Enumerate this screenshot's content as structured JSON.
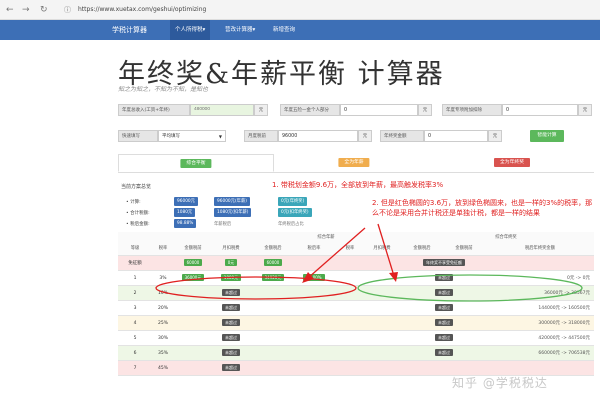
{
  "browser": {
    "url": "https://www.xuetax.com/geshui/optimizing"
  },
  "nav": {
    "brand": "学税计算器",
    "items": [
      "个人所得税▾",
      "营改计算器▾",
      "新增查询"
    ]
  },
  "page": {
    "title": "年终奖&年薪平衡 计算器",
    "subtitle": "知之为知之，不知为不知，是知也"
  },
  "form": {
    "row1": [
      {
        "label": "年度总收入(工资+年终)",
        "value": "",
        "placeholder": "480000",
        "unit": "元"
      },
      {
        "label": "年度五险一金个人部分",
        "value": "0",
        "unit": "元"
      },
      {
        "label": "年度专项附加扣除",
        "value": "0",
        "unit": "元"
      }
    ],
    "row2": {
      "type_label": "快速填写",
      "type_value": "平均填写",
      "salary_label": "月度税前",
      "salary_value": "96000",
      "salary_unit": "元",
      "bonus_label": "年终奖金额",
      "bonus_value": "0",
      "bonus_unit": "元",
      "button": "智能计算"
    }
  },
  "tabs": [
    {
      "label": "综合平衡",
      "color": "#5cb85c"
    },
    {
      "label": "全为年薪",
      "color": "#f0ad4e"
    },
    {
      "label": "全为年终奖",
      "color": "#d9534f"
    }
  ],
  "annotations": {
    "a1": "1. 带税划金额9.6万，全部放到年薪，最高触发税率3%",
    "a2": "2. 但是红色椭圆的3.6万，放到绿色椭圆来，也是一样的3%的税率，那么不论是采用合并计税还是单独计税，都是一样的结果"
  },
  "summary": {
    "heading": "当前方案总览",
    "rows": [
      {
        "label": "• 计算:",
        "chips": [
          "96000元",
          "96000元(年薪)",
          "0元(年终奖)"
        ]
      },
      {
        "label": "• 合计税额:",
        "chips": [
          "1080元",
          "1080元(扣年薪)",
          "0元(扣年终奖)"
        ]
      },
      {
        "label": "• 税后金额:",
        "chips": [
          "98.88%",
          "年薪税后",
          "年终税后占比"
        ]
      }
    ]
  },
  "table": {
    "group_left": "综合年薪",
    "group_right": "综合年终奖",
    "headers": [
      "等级",
      "税率",
      "金额税前",
      "月扣税费",
      "金额税后",
      "税后率",
      "税率",
      "月扣税费",
      "金额税后",
      "金额税前",
      "税后年终奖金额"
    ],
    "rows": [
      {
        "level": "免征额",
        "rate": "",
        "pre": "60000",
        "tax": "0元",
        "after": "60000",
        "pct": "",
        "note": "年终奖不享受免征额",
        "range": "",
        "bg": "#fce4e4"
      },
      {
        "level": "1",
        "rate": "3%",
        "pre": "36000元",
        "tax": "1080元",
        "after": "34920元",
        "pct": "97.00%",
        "note": "未超过",
        "range": "0元 -> 0元",
        "bg": "#ffffff"
      },
      {
        "level": "2",
        "rate": "10%",
        "pre": "",
        "tax": "未超过",
        "after": "",
        "pct": "",
        "note": "未超过",
        "range": "36000元 -> 38567元",
        "bg": "#eef7e6"
      },
      {
        "level": "3",
        "rate": "20%",
        "pre": "",
        "tax": "未超过",
        "after": "",
        "pct": "",
        "note": "未超过",
        "range": "144000元 -> 160500元",
        "bg": "#ffffff"
      },
      {
        "level": "4",
        "rate": "25%",
        "pre": "",
        "tax": "未超过",
        "after": "",
        "pct": "",
        "note": "未超过",
        "range": "300000元 -> 318000元",
        "bg": "#fdf6e3"
      },
      {
        "level": "5",
        "rate": "30%",
        "pre": "",
        "tax": "未超过",
        "after": "",
        "pct": "",
        "note": "未超过",
        "range": "420000元 -> 447500元",
        "bg": "#ffffff"
      },
      {
        "level": "6",
        "rate": "35%",
        "pre": "",
        "tax": "未超过",
        "after": "",
        "pct": "",
        "note": "未超过",
        "range": "660000元 -> 706538元",
        "bg": "#eef7e6"
      },
      {
        "level": "7",
        "rate": "45%",
        "pre": "",
        "tax": "未超过",
        "after": "",
        "pct": "",
        "note": "",
        "range": "",
        "bg": "#fce4e4"
      }
    ]
  },
  "watermark": "知乎 @学税税达"
}
